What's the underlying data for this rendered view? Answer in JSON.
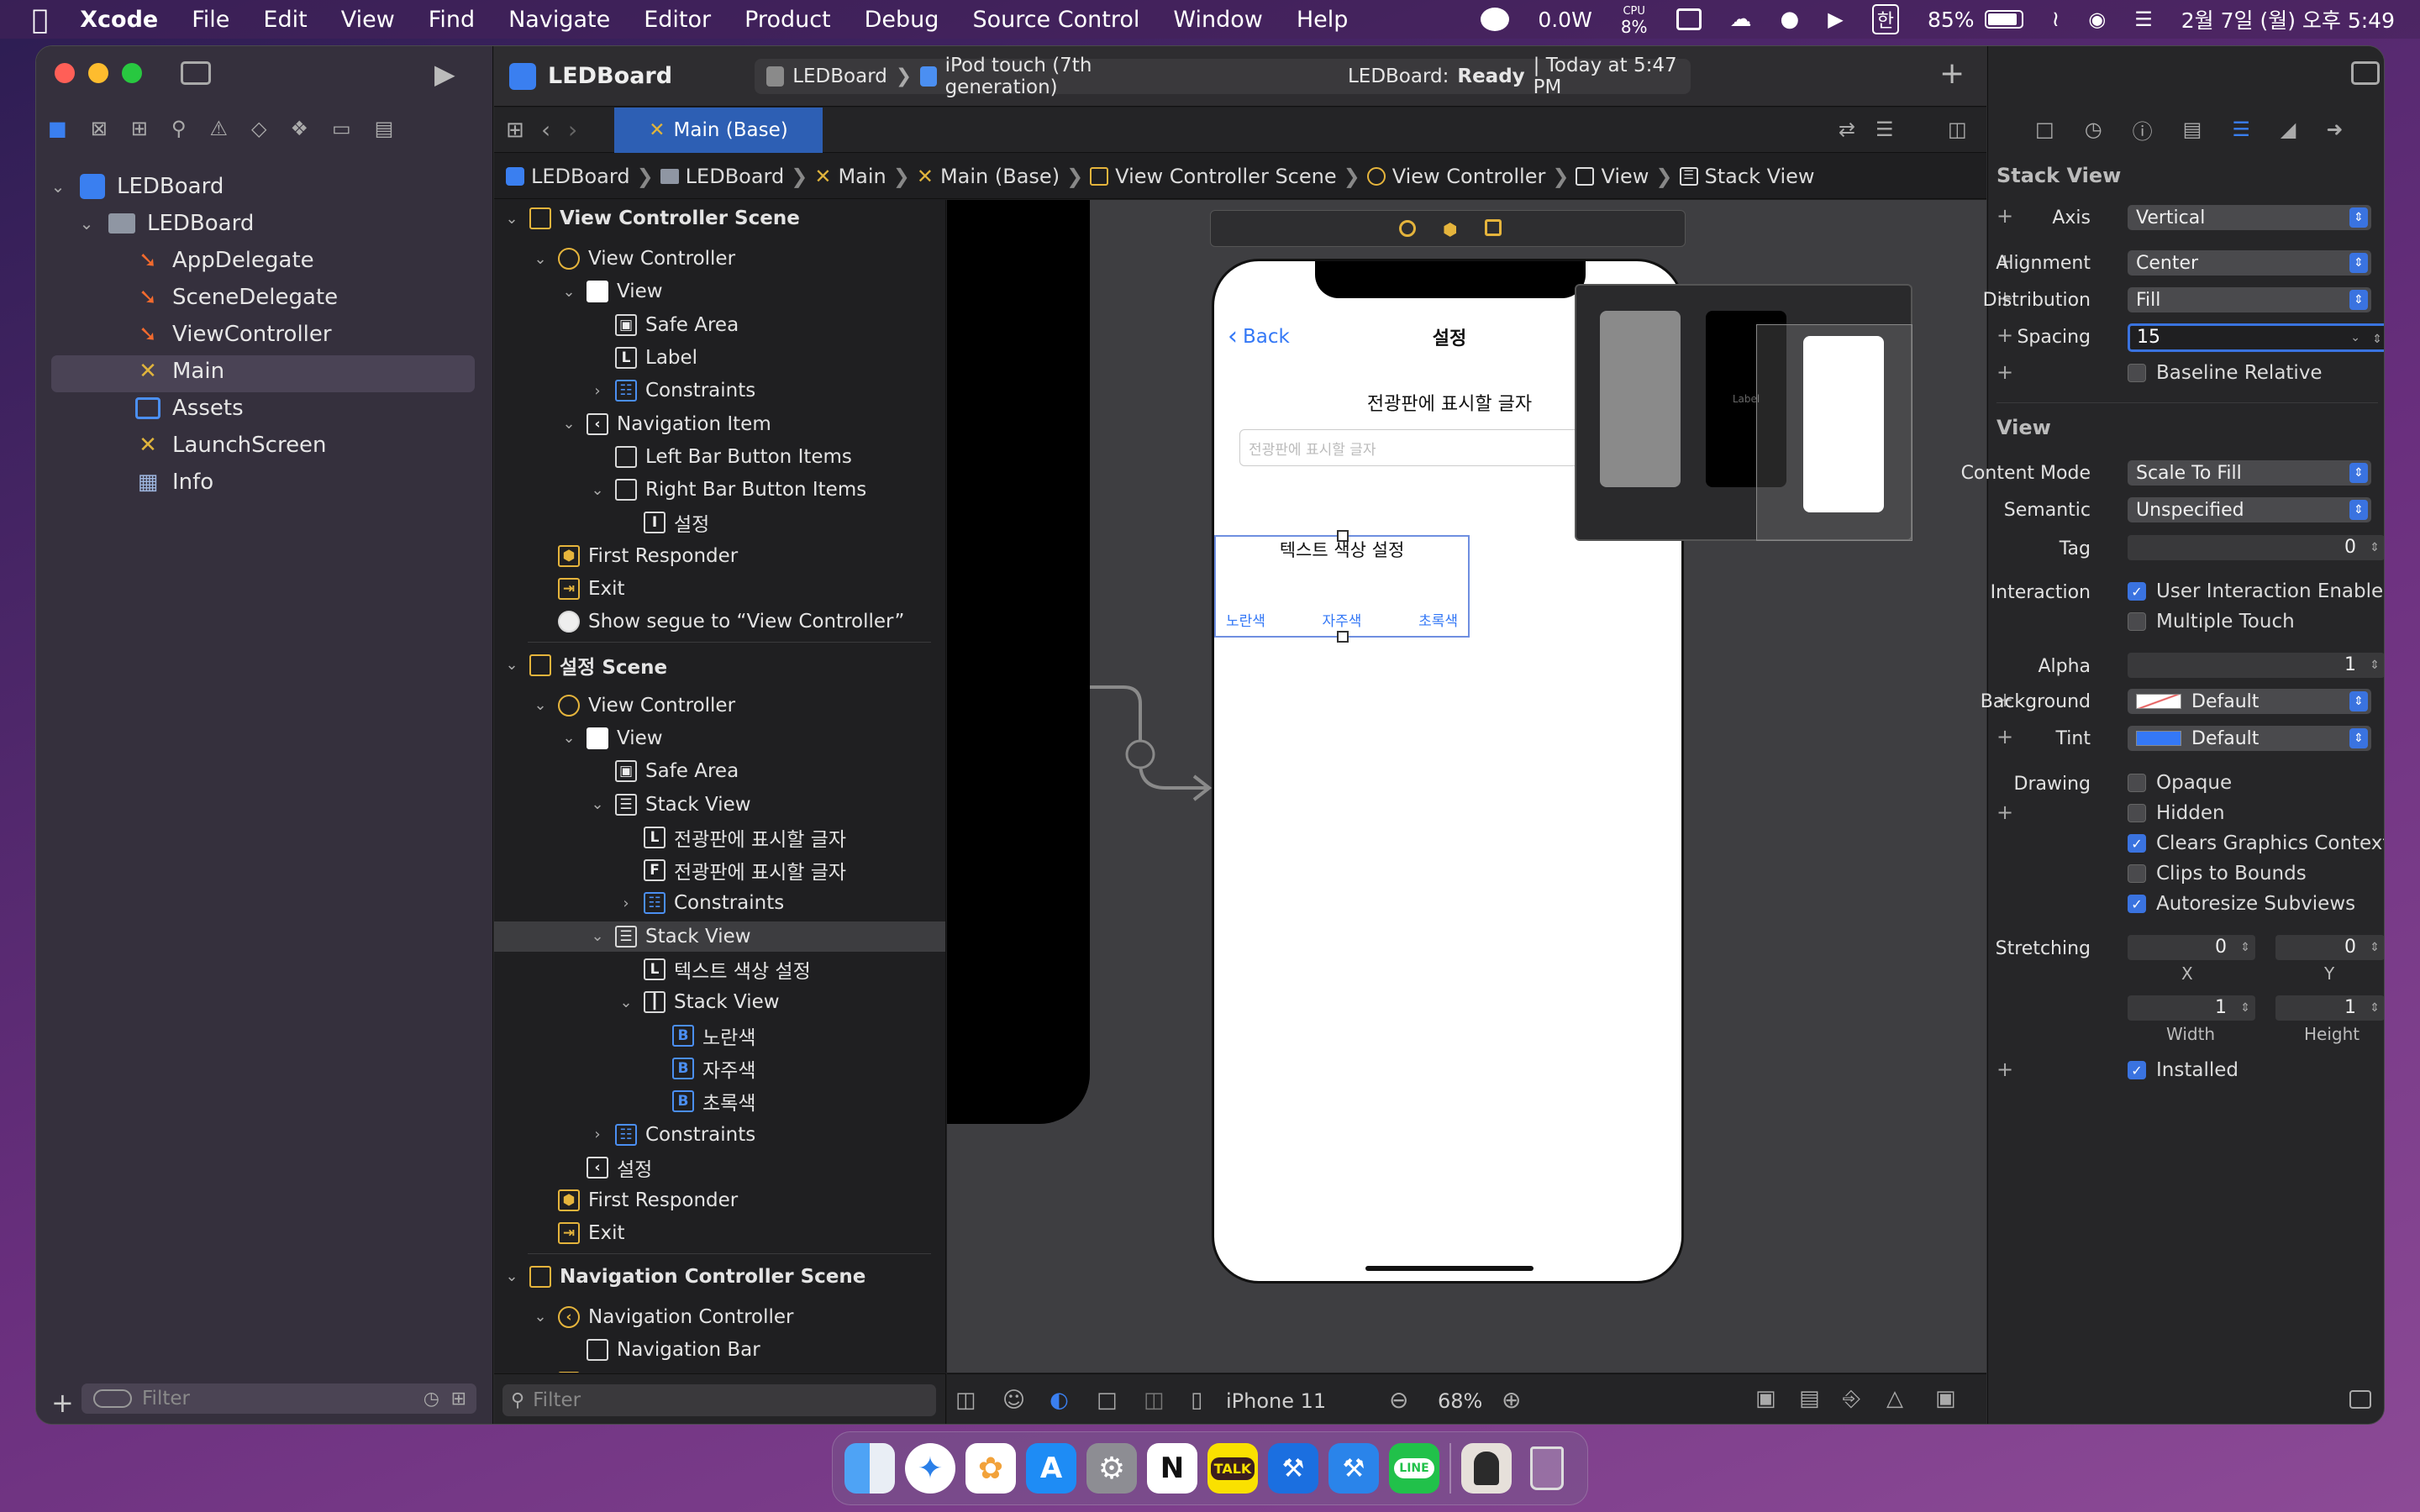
{
  "menubar": {
    "app_name": "Xcode",
    "items": [
      "File",
      "Edit",
      "View",
      "Find",
      "Navigate",
      "Editor",
      "Product",
      "Debug",
      "Source Control",
      "Window",
      "Help"
    ],
    "power": "0.0W",
    "cpu_label": "CPU",
    "cpu_value": "8%",
    "input_method": "한",
    "battery": "85%",
    "clock": "2월 7일 (월) 오후 5:49"
  },
  "navigator": {
    "items": [
      {
        "label": "LEDBoard",
        "kind": "project"
      },
      {
        "label": "LEDBoard",
        "kind": "folder"
      },
      {
        "label": "AppDelegate",
        "kind": "swift"
      },
      {
        "label": "SceneDelegate",
        "kind": "swift"
      },
      {
        "label": "ViewController",
        "kind": "swift"
      },
      {
        "label": "Main",
        "kind": "storyboard"
      },
      {
        "label": "Assets",
        "kind": "assets"
      },
      {
        "label": "LaunchScreen",
        "kind": "storyboard"
      },
      {
        "label": "Info",
        "kind": "plist"
      }
    ],
    "filter_placeholder": "Filter"
  },
  "toolbar": {
    "project": "LEDBoard",
    "scheme": "LEDBoard",
    "device": "iPod touch (7th generation)",
    "status_project": "LEDBoard:",
    "status_state": "Ready",
    "status_time": "| Today at 5:47 PM"
  },
  "tab": {
    "label": "Main (Base)"
  },
  "jumpbar": [
    "LEDBoard",
    "LEDBoard",
    "Main",
    "Main (Base)",
    "View Controller Scene",
    "View Controller",
    "View",
    "Stack View"
  ],
  "outline": {
    "rows": [
      {
        "label": "View Controller Scene",
        "icon": "scene",
        "bold": true
      },
      {
        "label": "View Controller",
        "icon": "vc"
      },
      {
        "label": "View",
        "icon": "view"
      },
      {
        "label": "Safe Area",
        "icon": "safearea"
      },
      {
        "label": "Label",
        "icon": "L"
      },
      {
        "label": "Constraints",
        "icon": "constraints"
      },
      {
        "label": "Navigation Item",
        "icon": "navitem"
      },
      {
        "label": "Left Bar Button Items",
        "icon": "barbutton"
      },
      {
        "label": "Right Bar Button Items",
        "icon": "barbutton"
      },
      {
        "label": "설정",
        "icon": "I"
      },
      {
        "label": "First Responder",
        "icon": "responder"
      },
      {
        "label": "Exit",
        "icon": "exit"
      },
      {
        "label": "Show segue to “View Controller”",
        "icon": "segue"
      },
      {
        "label": "설정 Scene",
        "icon": "scene",
        "bold": true
      },
      {
        "label": "View Controller",
        "icon": "vc"
      },
      {
        "label": "View",
        "icon": "view"
      },
      {
        "label": "Safe Area",
        "icon": "safearea"
      },
      {
        "label": "Stack View",
        "icon": "stack"
      },
      {
        "label": "전광판에 표시할 글자",
        "icon": "L"
      },
      {
        "label": "전광판에 표시할 글자",
        "icon": "F"
      },
      {
        "label": "Constraints",
        "icon": "constraints"
      },
      {
        "label": "Stack View",
        "icon": "stack",
        "selected": true
      },
      {
        "label": "텍스트 색상 설정",
        "icon": "L"
      },
      {
        "label": "Stack View",
        "icon": "hstack"
      },
      {
        "label": "노란색",
        "icon": "B"
      },
      {
        "label": "자주색",
        "icon": "B"
      },
      {
        "label": "초록색",
        "icon": "B"
      },
      {
        "label": "Constraints",
        "icon": "constraints"
      },
      {
        "label": "설정",
        "icon": "navitem"
      },
      {
        "label": "First Responder",
        "icon": "responder"
      },
      {
        "label": "Exit",
        "icon": "exit"
      },
      {
        "label": "Navigation Controller Scene",
        "icon": "scene",
        "bold": true
      },
      {
        "label": "Navigation Controller",
        "icon": "navctrl"
      },
      {
        "label": "Navigation Bar",
        "icon": "navbar"
      },
      {
        "label": "First Responder",
        "icon": "responder"
      },
      {
        "label": "Exit",
        "icon": "exit"
      }
    ],
    "filter_placeholder": "Filter"
  },
  "canvas": {
    "back_label": "Back",
    "nav_title": "설정",
    "heading": "전광판에 표시할 글자",
    "field_placeholder": "전광판에 표시할 글자",
    "color_title": "텍스트 색상 설정",
    "buttons": [
      "노란색",
      "자주색",
      "초록색"
    ],
    "minimap_label": "Label",
    "button_color": "#3478f6"
  },
  "canvas_bar": {
    "device": "iPhone 11",
    "zoom": "68%"
  },
  "inspector": {
    "stack_header": "Stack View",
    "axis_label": "Axis",
    "axis": "Vertical",
    "alignment_label": "Alignment",
    "alignment": "Center",
    "distribution_label": "Distribution",
    "distribution": "Fill",
    "spacing_label": "Spacing",
    "spacing": "15",
    "baseline": "Baseline Relative",
    "view_header": "View",
    "content_mode_label": "Content Mode",
    "content_mode": "Scale To Fill",
    "semantic_label": "Semantic",
    "semantic": "Unspecified",
    "tag_label": "Tag",
    "tag": "0",
    "interaction_label": "Interaction",
    "user_interaction": "User Interaction Enabled",
    "multiple_touch": "Multiple Touch",
    "alpha_label": "Alpha",
    "alpha": "1",
    "background_label": "Background",
    "background": "Default",
    "tint_label": "Tint",
    "tint": "Default",
    "drawing_label": "Drawing",
    "opaque": "Opaque",
    "hidden": "Hidden",
    "clears": "Clears Graphics Context",
    "clips": "Clips to Bounds",
    "autoresize": "Autoresize Subviews",
    "stretching_label": "Stretching",
    "stretch_x": "0",
    "stretch_y": "0",
    "stretch_w": "1",
    "stretch_h": "1",
    "x_label": "X",
    "y_label": "Y",
    "width_label": "Width",
    "height_label": "Height",
    "installed": "Installed"
  },
  "dock": [
    "Finder",
    "Safari",
    "Photos",
    "App Store",
    "System Preferences",
    "Notion",
    "KakaoTalk",
    "Xcode",
    "Xcode Beta",
    "LINE",
    "Photo",
    "Trash"
  ],
  "dock_notion": "N",
  "dock_kakao": "TALK",
  "dock_line": "LINE"
}
